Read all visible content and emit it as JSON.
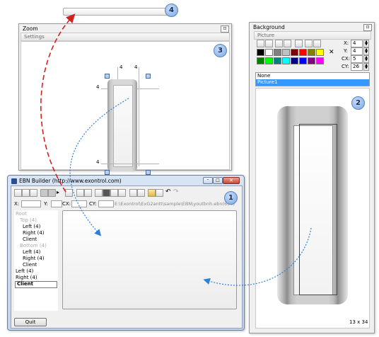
{
  "callouts": {
    "one": "1",
    "two": "2",
    "three": "3",
    "four": "4"
  },
  "zoom": {
    "title": "Zoom",
    "close": "⊡",
    "settings_label": "Settings",
    "ruler_top_left": "4",
    "ruler_top_right": "4",
    "ruler_left_top": "4",
    "ruler_left_bottom": "4"
  },
  "background": {
    "title": "Background",
    "close": "⊡",
    "picture_label": "Picture",
    "x_label": "X:",
    "x_value": "4",
    "y_label": "Y:",
    "y_value": "4",
    "cx_label": "CX:",
    "cx_value": "5",
    "cy_label": "CY:",
    "cy_value": "26",
    "list": [
      "None",
      "Picture1"
    ],
    "size_readout": "13 x 34",
    "colors": [
      "#000000",
      "#ffffff",
      "#808080",
      "#c0c0c0",
      "#800000",
      "#ff0000",
      "#808000",
      "#ffff00",
      "#008000",
      "#00ff00",
      "#008080",
      "#00ffff",
      "#000080",
      "#0000ff",
      "#800080",
      "#ff00ff"
    ]
  },
  "builder": {
    "title": "EBN Builder (http://www.exontrol.com)",
    "x_label": "X:",
    "y_label": "Y:",
    "cx_label": "CX:",
    "cy_label": "CY:",
    "path": "E:\\Exontrol\\ExG2antt\\sample\\EBN\\youtbnh.ebn(690)",
    "tree": [
      "Root",
      "Top (4)",
      "Left (4)",
      "Right (4)",
      "Client",
      "Bottom (4)",
      "Left (4)",
      "Right (4)",
      "Client",
      "Left (4)",
      "Right (4)",
      "Client"
    ],
    "quit_label": "Quit"
  }
}
